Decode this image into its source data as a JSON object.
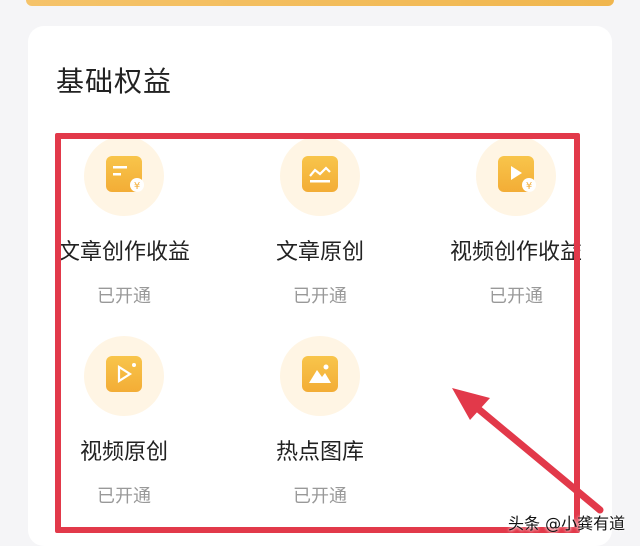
{
  "section": {
    "title": "基础权益"
  },
  "items": [
    {
      "label": "文章创作收益",
      "status": "已开通",
      "icon": "article-income-icon"
    },
    {
      "label": "文章原创",
      "status": "已开通",
      "icon": "article-original-icon"
    },
    {
      "label": "视频创作收益",
      "status": "已开通",
      "icon": "video-income-icon"
    },
    {
      "label": "视频原创",
      "status": "已开通",
      "icon": "video-original-icon"
    },
    {
      "label": "热点图库",
      "status": "已开通",
      "icon": "hot-gallery-icon"
    }
  ],
  "watermark": "头条 @小龚有道",
  "colors": {
    "accent": "#f3ad36",
    "highlight": "#e2394a",
    "icon_bg": "#fff5e4"
  }
}
